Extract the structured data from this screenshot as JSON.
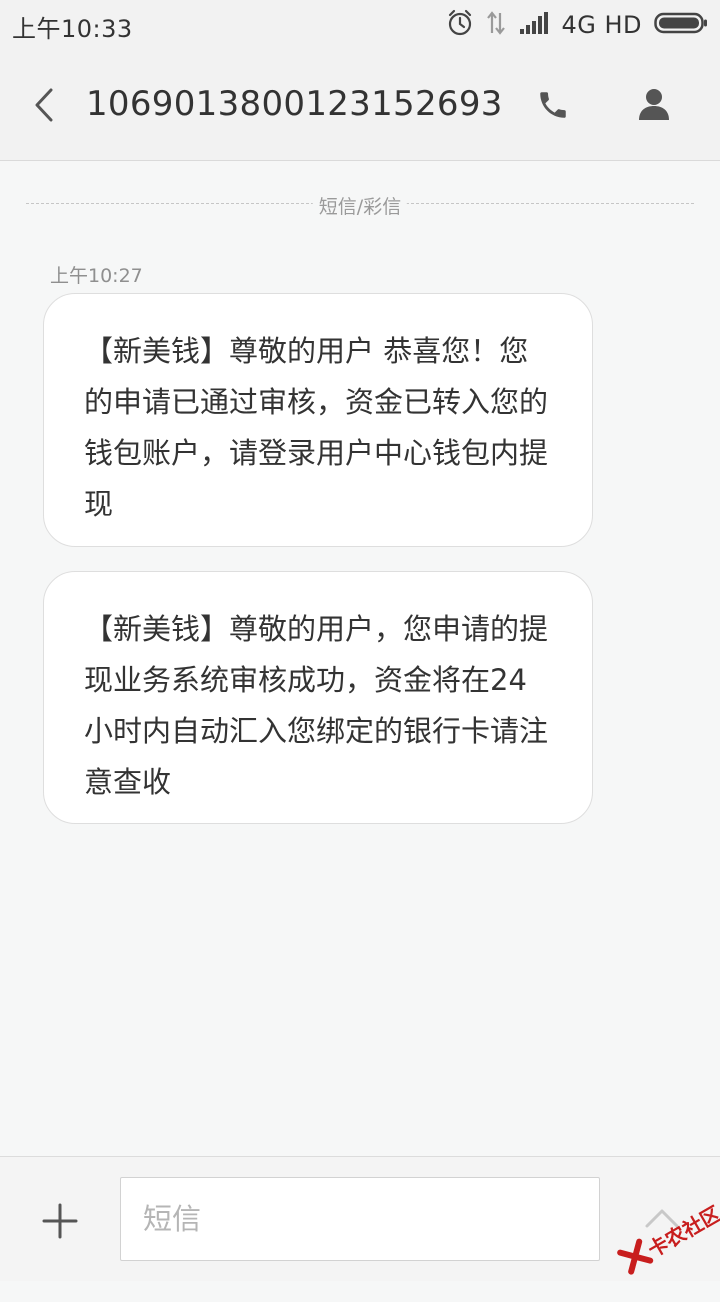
{
  "status_bar": {
    "time": "上午10:33",
    "network": "4G HD"
  },
  "header": {
    "title": "1069013800123152693",
    "icons": {
      "back": "chevron-left-icon",
      "call": "phone-icon",
      "contact": "person-icon"
    }
  },
  "thread": {
    "divider_label": "短信/彩信",
    "timestamp": "上午10:27",
    "messages": [
      {
        "text": "【新美钱】尊敬的用户 恭喜您！您的申请已通过审核，资金已转入您的钱包账户，请登录用户中心钱包内提现"
      },
      {
        "text": "【新美钱】尊敬的用户，您申请的提现业务系统审核成功，资金将在24小时内自动汇入您绑定的银行卡请注意查收"
      }
    ]
  },
  "composer": {
    "placeholder": "短信",
    "value": ""
  },
  "watermark": {
    "text": "卡农社区"
  },
  "colors": {
    "background": "#f6f7f7",
    "header_bg": "#f2f2f2",
    "bubble_bg": "#ffffff",
    "text": "#333333",
    "watermark": "#c81e1e"
  }
}
